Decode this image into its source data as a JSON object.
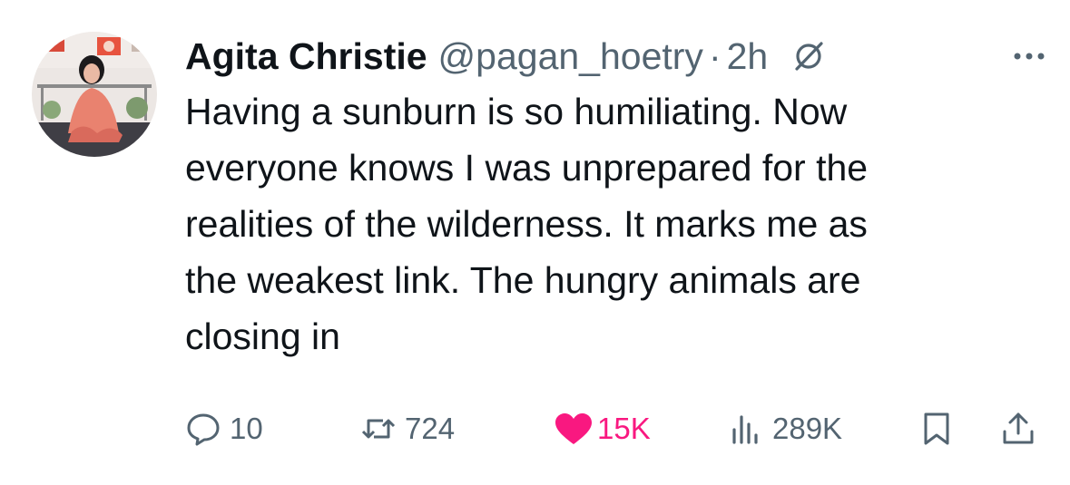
{
  "tweet": {
    "author": {
      "display_name": "Agita Christie",
      "handle": "@pagan_hoetry",
      "time": "2h",
      "separator": "·"
    },
    "text": "Having a sunburn is so humiliating. Now\neveryone knows I was unprepared for the\nrealities of the wilderness. It marks me as\nthe weakest link. The hungry animals are\nclosing in",
    "stats": {
      "replies": "10",
      "retweets": "724",
      "likes": "15K",
      "views": "289K"
    },
    "liked": true
  },
  "icons": {
    "grok": "grok-icon",
    "more": "more-icon",
    "reply": "reply-icon",
    "retweet": "retweet-icon",
    "like": "heart-icon",
    "views": "views-icon",
    "bookmark": "bookmark-icon",
    "share": "share-icon"
  },
  "colors": {
    "text": "#0f1419",
    "secondary": "#536471",
    "like": "#f91880"
  }
}
